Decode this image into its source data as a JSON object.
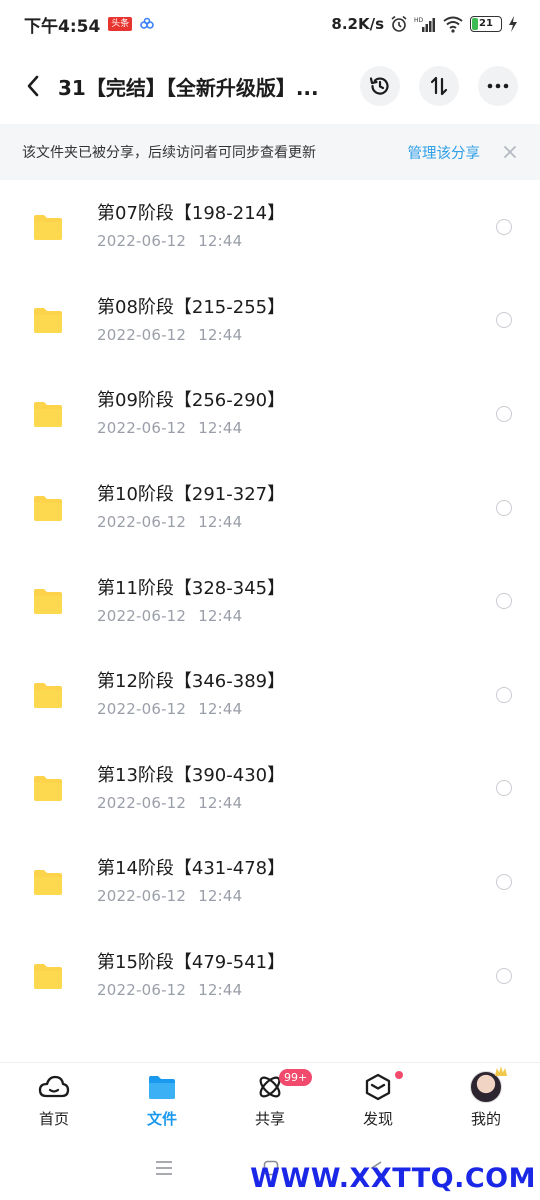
{
  "status_bar": {
    "time": "下午4:54",
    "news_badge": "头条",
    "network_speed": "8.2K/s",
    "battery_level": "21",
    "battery_percent": 21
  },
  "header": {
    "title": "31【完结】【全新升级版】...",
    "icons": [
      "back-icon",
      "history-icon",
      "sort-icon",
      "more-icon"
    ]
  },
  "notice": {
    "text": "该文件夹已被分享，后续访问者可同步查看更新",
    "action": "管理该分享"
  },
  "files": [
    {
      "name": "第07阶段【198-214】",
      "date": "2022-06-12",
      "time": "12:44"
    },
    {
      "name": "第08阶段【215-255】",
      "date": "2022-06-12",
      "time": "12:44"
    },
    {
      "name": "第09阶段【256-290】",
      "date": "2022-06-12",
      "time": "12:44"
    },
    {
      "name": "第10阶段【291-327】",
      "date": "2022-06-12",
      "time": "12:44"
    },
    {
      "name": "第11阶段【328-345】",
      "date": "2022-06-12",
      "time": "12:44"
    },
    {
      "name": "第12阶段【346-389】",
      "date": "2022-06-12",
      "time": "12:44"
    },
    {
      "name": "第13阶段【390-430】",
      "date": "2022-06-12",
      "time": "12:44"
    },
    {
      "name": "第14阶段【431-478】",
      "date": "2022-06-12",
      "time": "12:44"
    },
    {
      "name": "第15阶段【479-541】",
      "date": "2022-06-12",
      "time": "12:44"
    }
  ],
  "bottom_nav": {
    "home": "首页",
    "files": "文件",
    "share": "共享",
    "share_badge": "99+",
    "discover": "发现",
    "me": "我的"
  },
  "watermark": "WWW.XXTTQ.COM",
  "colors": {
    "accent": "#1a9aee",
    "link": "#2f9fe7",
    "folder": "#fcd34a",
    "badge": "#f14a6c"
  }
}
